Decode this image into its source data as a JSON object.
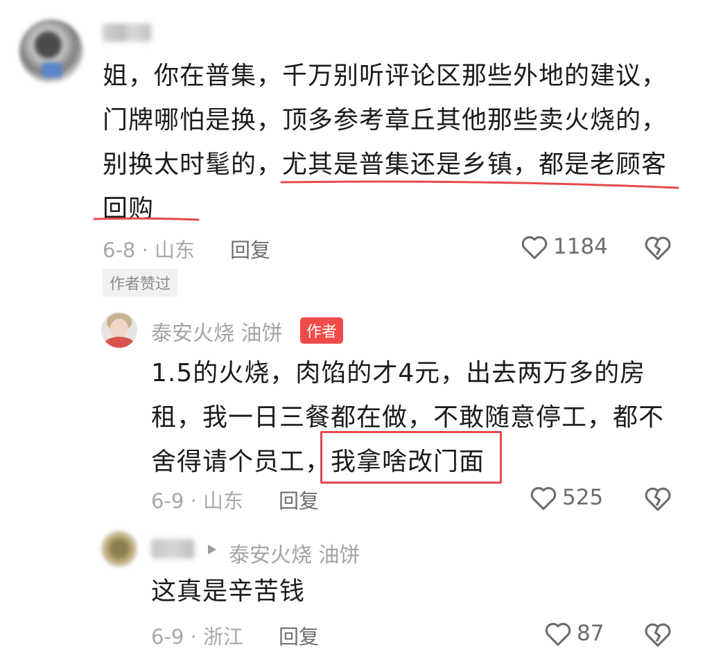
{
  "comments": [
    {
      "username": "晨鹏",
      "lines": [
        "姐，你在普集，千万别听评论区那些外地的建议，",
        "门牌哪怕是换，顶多参考章丘其他那些卖火烧的，",
        "别换太时髦的，",
        "尤其是普集还是乡镇，都是老顾客",
        "回购"
      ],
      "date_location": "6-8 · 山东",
      "reply_label": "回复",
      "like_count": "1184",
      "author_liked": "作者赞过"
    },
    {
      "username": "泰安火烧 油饼",
      "author_badge": "作者",
      "lines": [
        "1.5的火烧，肉馅的才4元，出去两万多的房",
        "租，我一日三餐都在做，不敢随意停工，都不",
        "舍得请个员工，",
        "我拿啥改门面"
      ],
      "date_location": "6-9 · 山东",
      "reply_label": "回复",
      "like_count": "525"
    },
    {
      "username": "青瑾",
      "reply_to": "泰安火烧 油饼",
      "lines": [
        "这真是辛苦钱"
      ],
      "date_location": "6-9 · 浙江",
      "reply_label": "回复",
      "like_count": "87"
    }
  ],
  "colors": {
    "highlight": "#e5484d",
    "author_badge": "#f04a4a"
  },
  "icons": [
    "heart-outline-icon",
    "broken-heart-icon",
    "play-triangle-icon"
  ]
}
